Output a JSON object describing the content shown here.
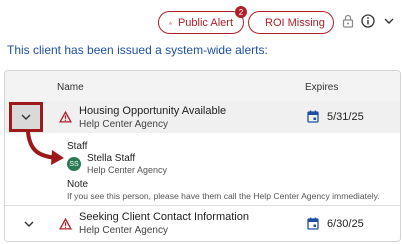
{
  "toolbar": {
    "public_alert_label": "Public Alert",
    "public_alert_count": "2",
    "roi_missing_label": "ROI Missing",
    "icons": [
      "warning-icon",
      "lock-icon",
      "info-icon",
      "chevron-down-icon"
    ]
  },
  "alerts_heading": "This client has been issued a system-wide alerts:",
  "table": {
    "col_name": "Name",
    "col_expires": "Expires",
    "rows": [
      {
        "title": "Housing Opportunity Available",
        "agency": "Help Center Agency",
        "expires": "5/31/25",
        "expanded": true
      },
      {
        "title": "Seeking Client Contact Information",
        "agency": "Help Center Agency",
        "expires": "6/30/25",
        "expanded": false
      }
    ]
  },
  "detail": {
    "staff_label": "Staff",
    "staff_initials": "SS",
    "staff_name": "Stella Staff",
    "staff_agency": "Help Center Agency",
    "note_label": "Note",
    "note_text": "If you see this person, please have them call the Help Center Agency immediately."
  },
  "colors": {
    "alert_red": "#b0202b",
    "link_blue": "#1f4fa0",
    "avatar_green": "#2a7a55",
    "annotation_red": "#9c1a1a"
  }
}
